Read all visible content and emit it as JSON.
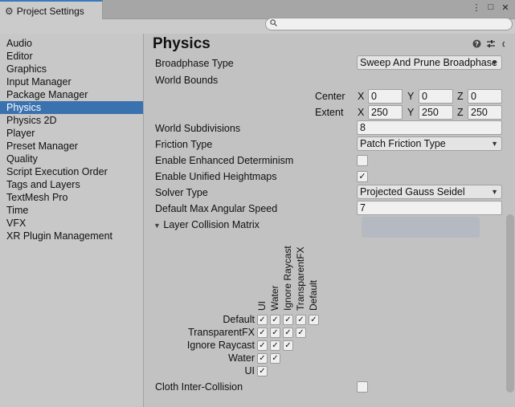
{
  "window": {
    "tab_title": "Project Settings",
    "tab_icon": "gear-icon",
    "controls": [
      "⋮",
      "□",
      "✕"
    ]
  },
  "search": {
    "placeholder": "",
    "value": "",
    "icon": "search-icon"
  },
  "sidebar": {
    "items": [
      {
        "label": "Audio"
      },
      {
        "label": "Editor"
      },
      {
        "label": "Graphics"
      },
      {
        "label": "Input Manager"
      },
      {
        "label": "Package Manager"
      },
      {
        "label": "Physics",
        "selected": true
      },
      {
        "label": "Physics 2D"
      },
      {
        "label": "Player"
      },
      {
        "label": "Preset Manager"
      },
      {
        "label": "Quality"
      },
      {
        "label": "Script Execution Order"
      },
      {
        "label": "Tags and Layers"
      },
      {
        "label": "TextMesh Pro"
      },
      {
        "label": "Time"
      },
      {
        "label": "VFX"
      },
      {
        "label": "XR Plugin Management"
      }
    ],
    "selected_color": "#3a72b0"
  },
  "main": {
    "title": "Physics",
    "head_icons": [
      "help-icon",
      "preset-icon",
      "settings-icon"
    ],
    "broadphase": {
      "label": "Broadphase Type",
      "value": "Sweep And Prune Broadphase"
    },
    "world_bounds": {
      "label": "World Bounds",
      "center_label": "Center",
      "extent_label": "Extent",
      "center": {
        "x": "0",
        "y": "0",
        "z": "0"
      },
      "extent": {
        "x": "250",
        "y": "250",
        "z": "250"
      },
      "x_label": "X",
      "y_label": "Y",
      "z_label": "Z"
    },
    "world_subdivisions": {
      "label": "World Subdivisions",
      "value": "8"
    },
    "friction_type": {
      "label": "Friction Type",
      "value": "Patch Friction Type"
    },
    "enhanced_determinism": {
      "label": "Enable Enhanced Determinism",
      "checked": false
    },
    "unified_heightmaps": {
      "label": "Enable Unified Heightmaps",
      "checked": true
    },
    "solver_type": {
      "label": "Solver Type",
      "value": "Projected Gauss Seidel"
    },
    "max_angular_speed": {
      "label": "Default Max Angular Speed",
      "value": "7"
    },
    "layer_collision": {
      "label": "Layer Collision Matrix",
      "columns": [
        "UI",
        "Water",
        "Ignore Raycast",
        "TransparentFX",
        "Default"
      ],
      "rows": [
        "Default",
        "TransparentFX",
        "Ignore Raycast",
        "Water",
        "UI"
      ]
    },
    "cloth_inter_collision": {
      "label": "Cloth Inter-Collision",
      "checked": false
    }
  }
}
